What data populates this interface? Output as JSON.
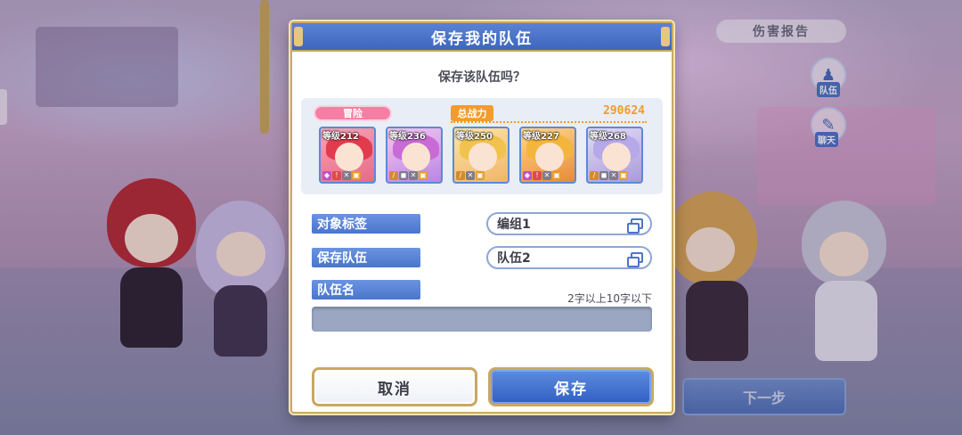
{
  "hud": {
    "damage_report": "伤害报告",
    "team_label": "队伍",
    "chat_label": "聊天",
    "next_step": "下一步"
  },
  "dialog": {
    "title": "保存我的队伍",
    "question": "保存该队伍吗？",
    "mode_badge": "冒险",
    "power_label": "总战力",
    "power_value": "290624",
    "characters": [
      {
        "level": "等级212",
        "hair_color": "#e23b4e"
      },
      {
        "level": "等级236",
        "hair_color": "#c86bd6"
      },
      {
        "level": "等级250",
        "hair_color": "#f1c24e"
      },
      {
        "level": "等级227",
        "hair_color": "#f4b53c"
      },
      {
        "level": "等级268",
        "hair_color": "#b6a9e8"
      }
    ],
    "target_tag_label": "对象标签",
    "target_tag_value": "编组1",
    "save_team_label": "保存队伍",
    "save_team_value": "队伍2",
    "team_name_label": "队伍名",
    "name_hint": "2字以上10字以下",
    "team_name_value": "",
    "cancel_label": "取消",
    "save_label": "保存"
  },
  "colors": {
    "accent_blue": "#4a76cb",
    "gold_border": "#c9a864",
    "power_orange": "#f39b2c",
    "mode_pink": "#f57fa4"
  }
}
